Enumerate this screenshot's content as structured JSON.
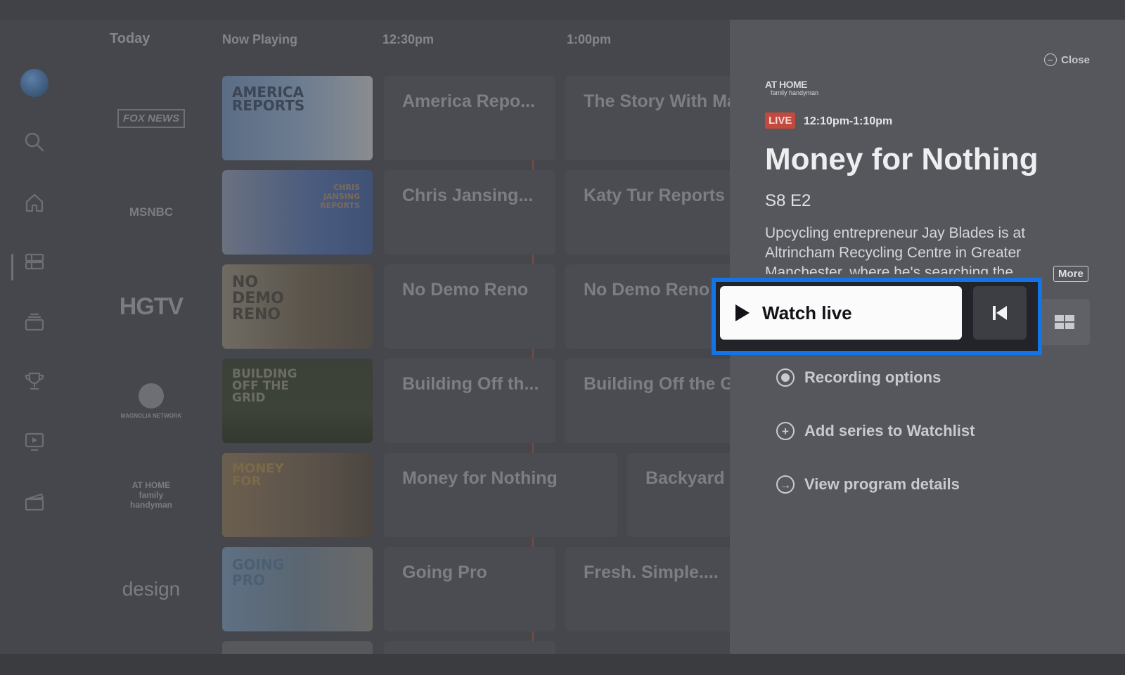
{
  "guide": {
    "headers": {
      "today": "Today",
      "now_playing": "Now Playing",
      "t1": "12:30pm",
      "t2": "1:00pm"
    },
    "channels": [
      {
        "logo_text": "FOX NEWS",
        "thumb_title": "AMERICA REPORTS",
        "thumb_color": "#5b6d86",
        "now": "America Repo...",
        "next": "The Story With Ma"
      },
      {
        "logo_text": "MSNBC",
        "thumb_title": "CHRIS JANSING REPORTS",
        "thumb_color": "#4a5b7e",
        "now": "Chris Jansing...",
        "next": "Katy Tur Reports"
      },
      {
        "logo_text": "HGTV",
        "thumb_title": "NO DEMO RENO",
        "thumb_color": "#5b554c",
        "now": "No Demo Reno",
        "next": "No Demo Reno"
      },
      {
        "logo_text": "MAGNOLIA NETWORK",
        "thumb_title": "BUILDING OFF THE GRID",
        "thumb_color": "#3d4338",
        "now": "Building Off th...",
        "next": "Building Off the G"
      },
      {
        "logo_text": "AT HOME family handyman",
        "thumb_title": "MONEY FOR",
        "thumb_color": "#5b524a",
        "now": "Money for Nothing",
        "next": "Backyard"
      },
      {
        "logo_text": "design",
        "thumb_title": "GOING PRO",
        "thumb_color": "#5a6672",
        "now": "Going Pro",
        "next": "Fresh. Simple...."
      }
    ]
  },
  "detail": {
    "close_label": "Close",
    "network_logo": "AT HOME",
    "network_sub": "family handyman",
    "live_label": "LIVE",
    "time_range": "12:10pm-1:10pm",
    "title": "Money for Nothing",
    "episode": "S8 E2",
    "description": "Upcycling entrepreneur Jay Blades is at Altrincham Recycling Centre in Greater Manchester, where he's searching the...",
    "more_label": "More",
    "watch_label": "Watch live",
    "options": [
      {
        "label": "Recording options",
        "icon": "record-icon"
      },
      {
        "label": "Add series to Watchlist",
        "icon": "plus-circle-icon"
      },
      {
        "label": "View program details",
        "icon": "arrow-right-circle-icon"
      }
    ]
  },
  "colors": {
    "accent_focus": "#1474e6",
    "live_badge": "#c2493e",
    "panel_bg": "#55575c"
  }
}
